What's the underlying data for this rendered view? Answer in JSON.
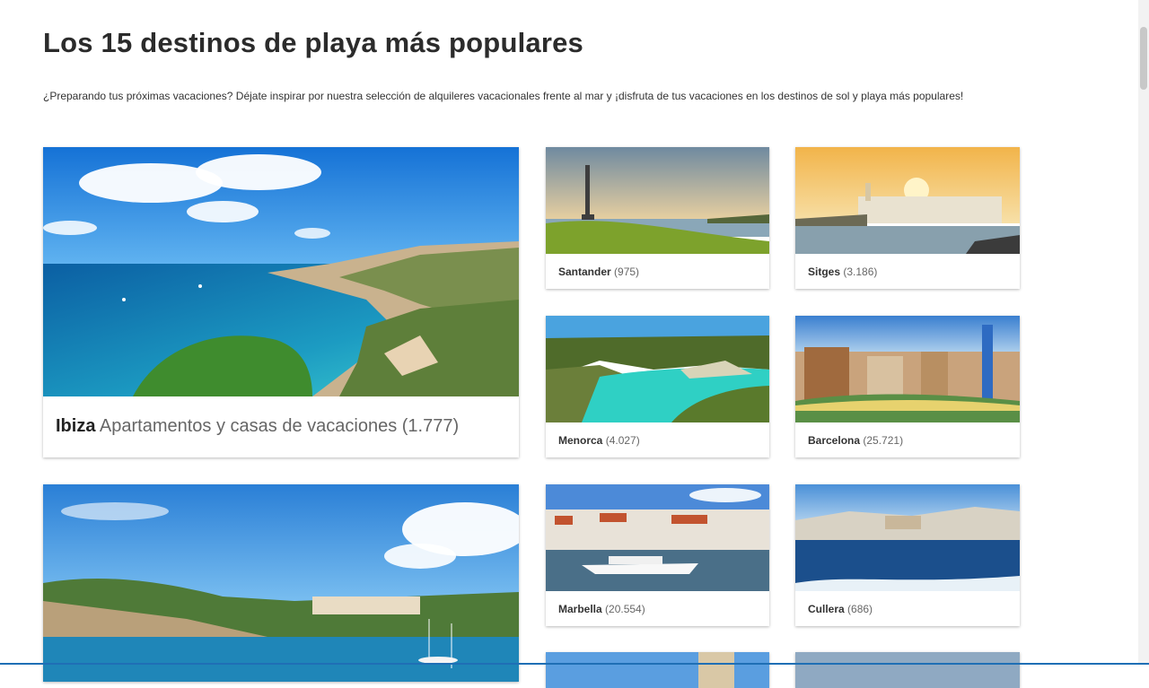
{
  "page": {
    "title": "Los 15 destinos de playa más populares",
    "intro": "¿Preparando tus próximas vacaciones? Déjate inspirar por nuestra selección de alquileres vacacionales frente al mar y ¡disfruta de tus vacaciones en los destinos de sol y playa más populares!"
  },
  "featured": {
    "name": "Ibiza",
    "subtitle": "Apartamentos y casas de vacaciones",
    "count": "(1.777)"
  },
  "destinations": [
    {
      "name": "Santander",
      "count": "(975)"
    },
    {
      "name": "Sitges",
      "count": "(3.186)"
    },
    {
      "name": "Menorca",
      "count": "(4.027)"
    },
    {
      "name": "Barcelona",
      "count": "(25.721)"
    },
    {
      "name": "Marbella",
      "count": "(20.554)"
    },
    {
      "name": "Cullera",
      "count": "(686)"
    }
  ],
  "colors": {
    "sky": "#2f8fe0",
    "sea": "#1a8fb5",
    "accent": "#1f6fb5"
  }
}
